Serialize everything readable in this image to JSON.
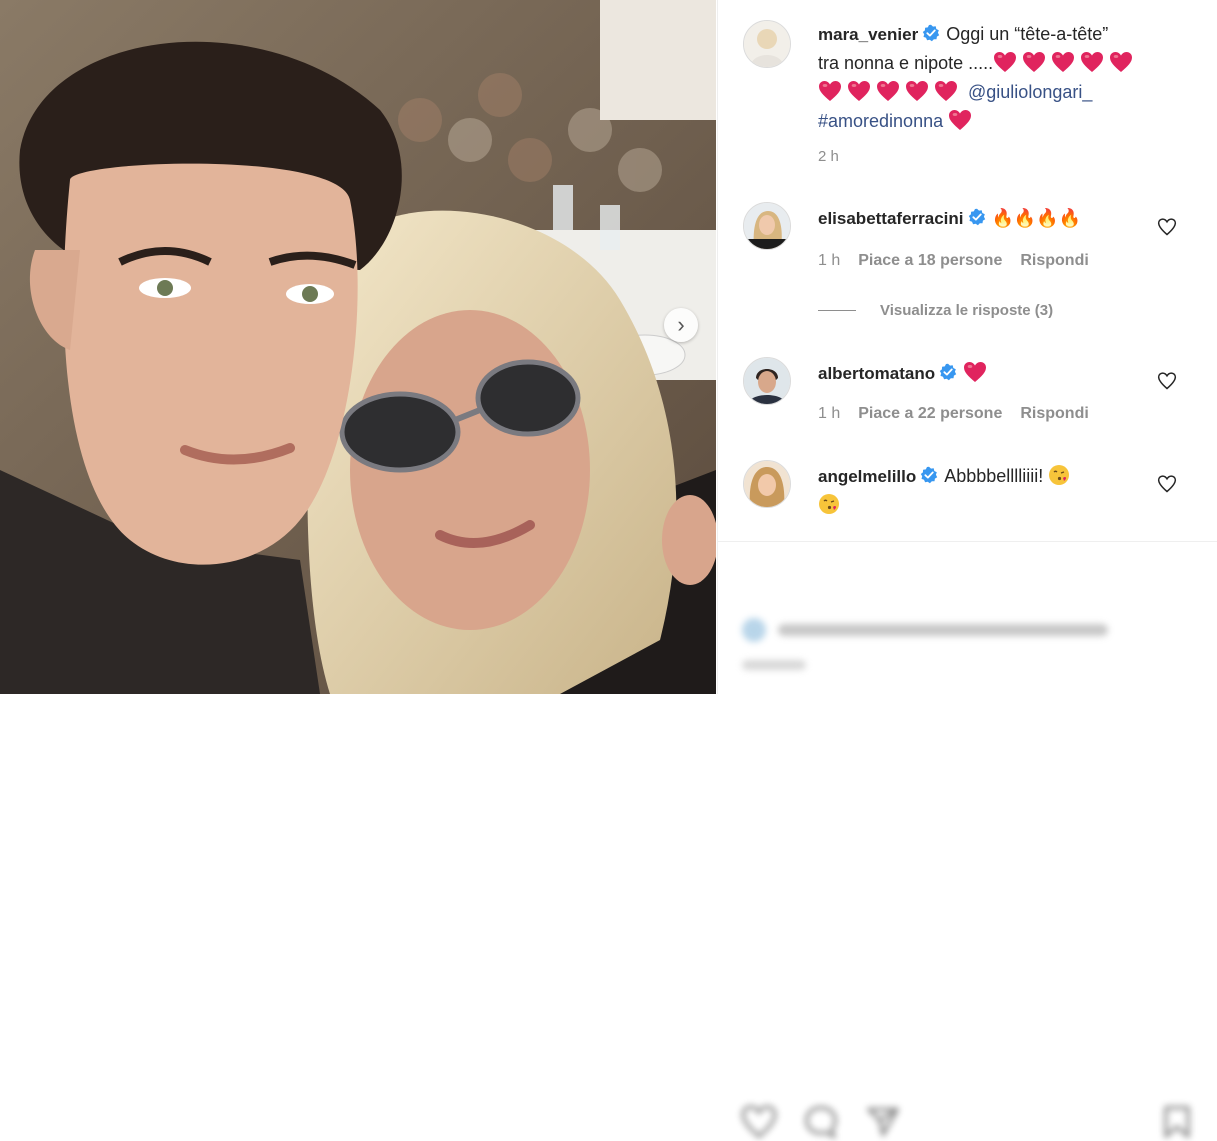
{
  "post": {
    "author": "mara_venier",
    "caption_line1": "Oggi un “tête-a-tête”",
    "caption_line2_prefix": "tra nonna e nipote .....",
    "mention": "@giuliolongari_",
    "hashtag": "#amoredinonna",
    "time": "2 h",
    "verified_icon": "verified-badge-icon",
    "heart_icon": "red-heart-emoji"
  },
  "comments": [
    {
      "user": "elisabettaferracini",
      "text": "🔥🔥🔥🔥",
      "time": "1 h",
      "likes": "Piace a 18 persone",
      "reply": "Rispondi",
      "view_replies": "Visualizza le risposte (3)"
    },
    {
      "user": "albertomatano",
      "text": "",
      "time": "1 h",
      "likes": "Piace a 22 persone",
      "reply": "Rispondi"
    },
    {
      "user": "angelmelillo",
      "text": "Abbbbelllliiii!",
      "kiss_emoji": "face-blowing-kiss-emoji"
    }
  ],
  "actions": {
    "icons": [
      "heart-outline-icon",
      "comment-icon",
      "share-icon",
      "bookmark-icon"
    ]
  },
  "colors": {
    "verified_blue": "#3897f0",
    "heart_red": "#e0245e",
    "link_blue": "#385185",
    "meta_gray": "#8e8e8e"
  }
}
